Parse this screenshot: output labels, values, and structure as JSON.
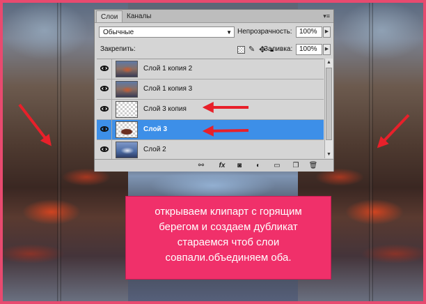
{
  "panel": {
    "tabs": [
      {
        "label": "Слои",
        "active": true
      },
      {
        "label": "Каналы",
        "active": false
      }
    ],
    "menu_icon": "panel-menu-icon",
    "blend_mode": "Обычные",
    "opacity_label": "Непрозрачность:",
    "opacity_value": "100%",
    "lock_label": "Закрепить:",
    "fill_label": "Заливка:",
    "fill_value": "100%"
  },
  "layers": [
    {
      "name": "Слой 1 копия 2",
      "visible": true,
      "selected": false,
      "thumb": "photo"
    },
    {
      "name": "Слой 1 копия 3",
      "visible": true,
      "selected": false,
      "thumb": "photo"
    },
    {
      "name": "Слой 3 копия",
      "visible": true,
      "selected": false,
      "thumb": "blank"
    },
    {
      "name": "Слой 3",
      "visible": true,
      "selected": true,
      "thumb": "clipart"
    },
    {
      "name": "Слой 2",
      "visible": true,
      "selected": false,
      "thumb": "blue"
    }
  ],
  "bottom_bar": {
    "icons": [
      "link-icon",
      "fx-icon",
      "mask-icon",
      "adjustment-icon",
      "folder-icon",
      "new-layer-icon",
      "trash-icon"
    ],
    "fx_label": "fx"
  },
  "caption": {
    "lines": [
      "открываем клипарт с горящим",
      "берегом и создаем дубликат",
      "стараемся чтоб слои",
      "совпали.объединяем оба."
    ]
  },
  "colors": {
    "frame": "#e84a6f",
    "caption_bg": "#f0306a",
    "arrow": "#e8202a",
    "selected_row": "#3d8fe8"
  }
}
